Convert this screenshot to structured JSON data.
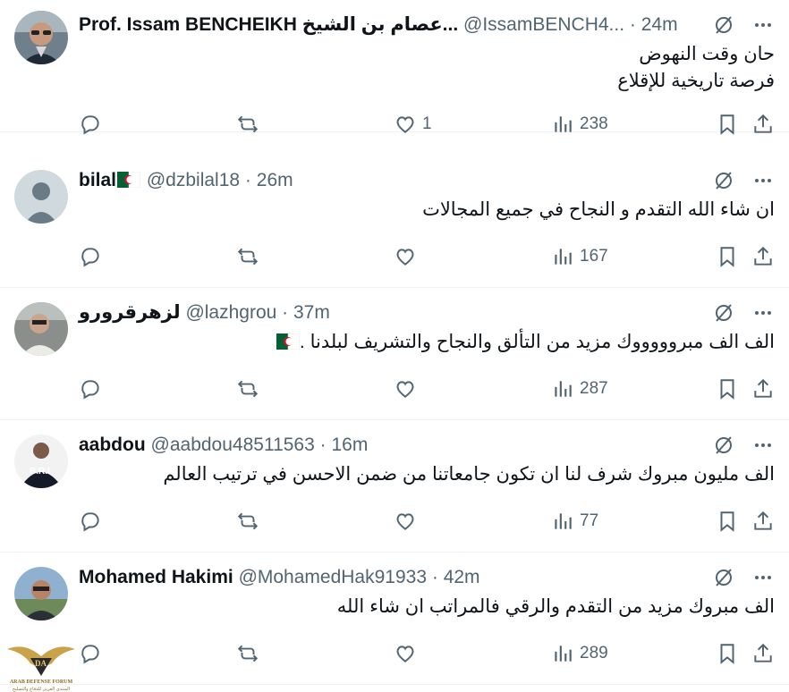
{
  "colors": {
    "text": "#0f1419",
    "muted": "#536471",
    "divider": "#eff3f4"
  },
  "tweets": [
    {
      "name": "Prof. Issam BENCHEIKH عصام بن الشيخ...",
      "handle": "@IssamBENCH4...",
      "dot": "·",
      "time": "24m",
      "lines": [
        "حان وقت النهوض",
        "فرصة تاريخية للإقلاع"
      ],
      "likes": "1",
      "views": "238",
      "avatar": "glasses-man"
    },
    {
      "name": "bilal",
      "name_flag": "algeria-flag",
      "handle": "@dzbilal18",
      "dot": "·",
      "time": "26m",
      "lines": [
        "ان شاء الله التقدم و النجاح في جميع المجالات"
      ],
      "likes": "",
      "views": "167",
      "avatar": "default-silhouette"
    },
    {
      "name": "لزهرقرورو",
      "handle": "@lazhgrou",
      "dot": "·",
      "time": "37m",
      "lines": [
        "الف الف مبروووووك مزيد من التألق والنجاح والتشريف لبلدنا ."
      ],
      "body_flag": "algeria-flag",
      "likes": "",
      "views": "287",
      "avatar": "car-selfie"
    },
    {
      "name": "aabdou",
      "handle": "@aabdou48511563",
      "dot": "·",
      "time": "16m",
      "lines": [
        "الف مليون مبروك شرف لنا ان تكون جامعاتنا من ضمن الاحسن في ترتيب العالم"
      ],
      "likes": "",
      "views": "77",
      "avatar": "bri-logo"
    },
    {
      "name": "Mohamed Hakimi",
      "handle": "@MohamedHak91933",
      "dot": "·",
      "time": "42m",
      "lines": [
        "الف مبروك مزيد من التقدم والرقي فالمراتب ان شاء الله"
      ],
      "likes": "",
      "views": "289",
      "avatar": "outdoor-man"
    }
  ],
  "watermark": {
    "title": "ARAB DEFENSE FORUM",
    "subtitle": "المنتدى العربي للدفاع والتسليح",
    "badge": "DA"
  }
}
